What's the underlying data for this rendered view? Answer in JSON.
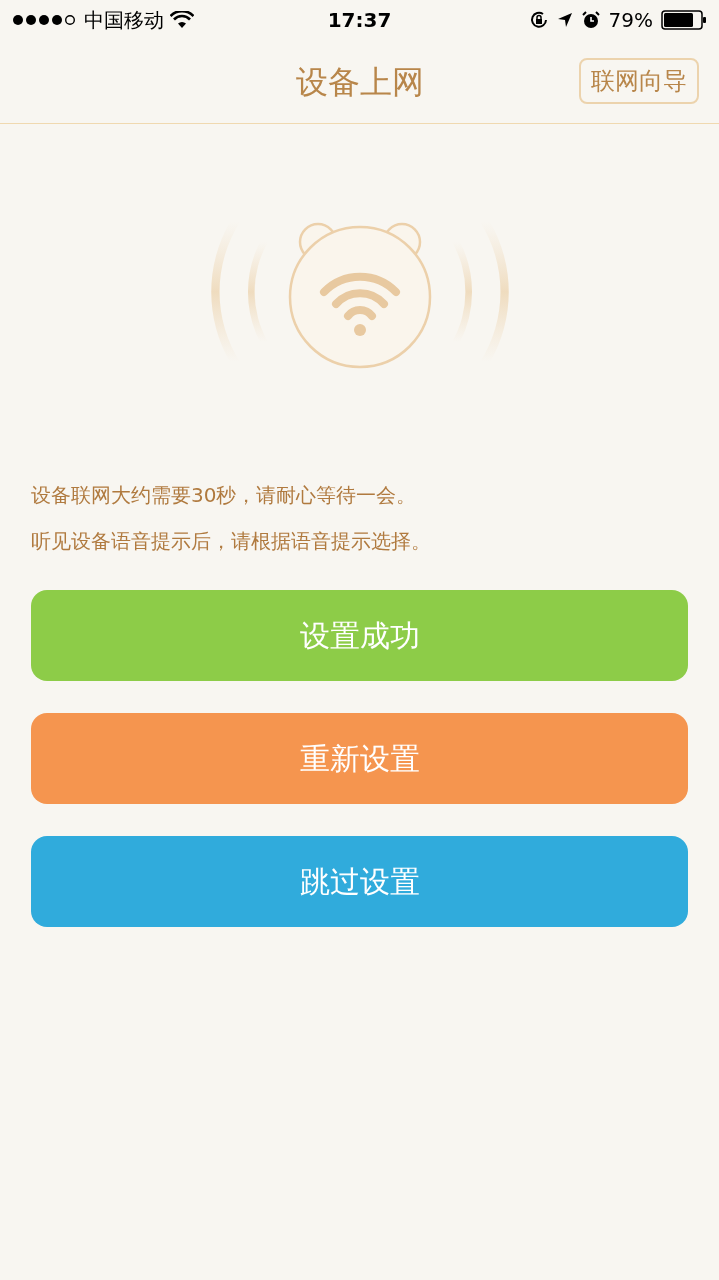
{
  "status_bar": {
    "carrier": "中国移动",
    "time": "17:37",
    "battery": "79%"
  },
  "nav": {
    "title": "设备上网",
    "guide_button": "联网向导"
  },
  "messages": [
    "设备联网大约需要30秒，请耐心等待一会。",
    "听见设备语音提示后，请根据语音提示选择。"
  ],
  "buttons": [
    {
      "label": "设置成功",
      "kind": "success"
    },
    {
      "label": "重新设置",
      "kind": "reset"
    },
    {
      "label": "跳过设置",
      "kind": "skip"
    }
  ]
}
